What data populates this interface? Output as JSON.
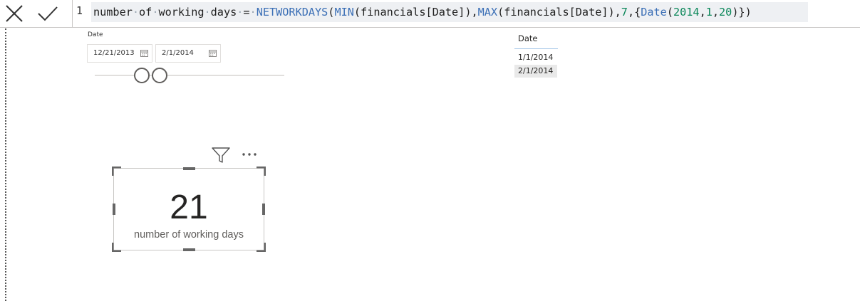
{
  "formula_bar": {
    "cancel_icon": "close-icon",
    "commit_icon": "checkmark-icon",
    "line_number": "1",
    "tokens": [
      {
        "t": "number",
        "c": "measure"
      },
      {
        "t": "·",
        "c": "dot"
      },
      {
        "t": "of",
        "c": "measure"
      },
      {
        "t": "·",
        "c": "dot"
      },
      {
        "t": "working",
        "c": "measure"
      },
      {
        "t": "·",
        "c": "dot"
      },
      {
        "t": "days",
        "c": "measure"
      },
      {
        "t": "·",
        "c": "dot"
      },
      {
        "t": "=",
        "c": "eq"
      },
      {
        "t": "·",
        "c": "dot"
      },
      {
        "t": "NETWORKDAYS",
        "c": "fn"
      },
      {
        "t": "(",
        "c": "punc"
      },
      {
        "t": "MIN",
        "c": "fn"
      },
      {
        "t": "(financials[Date]),",
        "c": "ref"
      },
      {
        "t": "MAX",
        "c": "fn"
      },
      {
        "t": "(financials[Date]),",
        "c": "ref"
      },
      {
        "t": "7",
        "c": "num"
      },
      {
        "t": ",{",
        "c": "punc"
      },
      {
        "t": "Date",
        "c": "fn"
      },
      {
        "t": "(",
        "c": "punc"
      },
      {
        "t": "2014",
        "c": "num"
      },
      {
        "t": ",",
        "c": "punc"
      },
      {
        "t": "1",
        "c": "num"
      },
      {
        "t": ",",
        "c": "punc"
      },
      {
        "t": "20",
        "c": "num"
      },
      {
        "t": ")})",
        "c": "punc"
      }
    ]
  },
  "date_slicer": {
    "title": "Date",
    "from": "12/21/2013",
    "to": "2/1/2014",
    "calendar_icon": "calendar-icon"
  },
  "list_slicer": {
    "header": "Date",
    "items": [
      "1/1/2014",
      "2/1/2014"
    ]
  },
  "card": {
    "value": "21",
    "label": "number of working days",
    "filter_icon": "filter-icon",
    "more_icon": "more-options-icon"
  },
  "colors": {
    "dax_function": "#3b6fb6",
    "dax_number": "#098658",
    "formula_background": "#eef0f3",
    "selected_item": "#e9e9e9"
  }
}
